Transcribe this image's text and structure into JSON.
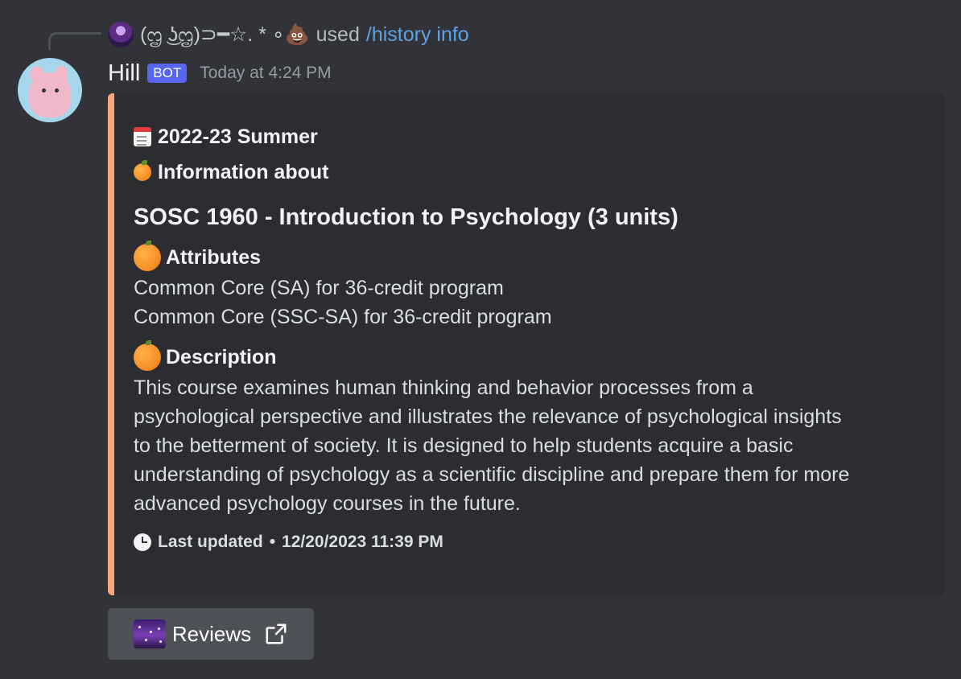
{
  "reply": {
    "user_name": "(ᦗ ͜ʖᦗ)⊃━☆. * ∘💩",
    "used_text": "used",
    "command": "/history info"
  },
  "message": {
    "author": "Hill",
    "bot_tag": "BOT",
    "timestamp": "Today at 4:24 PM"
  },
  "embed": {
    "accent_color": "#f3a978",
    "term": "2022-23 Summer",
    "info_header": "Information about",
    "course_title": "SOSC 1960 - Introduction to Psychology (3 units)",
    "fields": [
      {
        "name": "Attributes",
        "lines": [
          "Common Core (SA) for 36-credit program",
          "Common Core (SSC-SA) for 36-credit program"
        ]
      },
      {
        "name": "Description",
        "lines": [
          "This course examines human thinking and behavior processes from a",
          "psychological perspective and illustrates the relevance of psychological insights",
          "to the betterment of society. It is designed to help students acquire a basic",
          "understanding of psychology as a scientific discipline and prepare them for more",
          "advanced psychology courses in the future."
        ]
      }
    ],
    "footer_label": "Last updated",
    "footer_separator": "•",
    "footer_date": "12/20/2023 11:39 PM"
  },
  "button": {
    "label": "Reviews",
    "icon": "milky-way-icon",
    "trailing_icon": "external-link-icon"
  },
  "icons": {
    "term": "calendar-icon",
    "info": "tangerine-icon",
    "field": "orange-icon",
    "footer": "clock-icon"
  },
  "colors": {
    "background": "#313338",
    "embed_background": "#2b2d31",
    "bot_tag": "#5865f2",
    "command_link": "#5ea1e3",
    "button": "#4e5058"
  }
}
